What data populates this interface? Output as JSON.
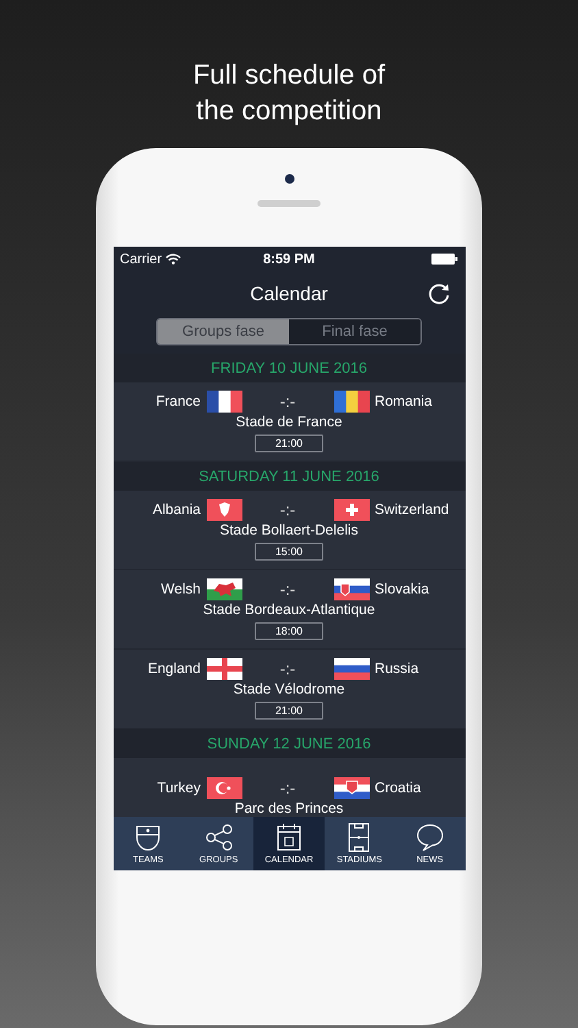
{
  "headline": "Full schedule of the competition",
  "status_bar": {
    "carrier": "Carrier",
    "time": "8:59 PM"
  },
  "nav": {
    "title": "Calendar"
  },
  "segments": [
    {
      "label": "Groups fase",
      "selected": true
    },
    {
      "label": "Final fase",
      "selected": false
    }
  ],
  "days": [
    {
      "date": "FRIDAY 10 JUNE 2016",
      "matches": [
        {
          "home": {
            "name": "France",
            "kind": "fr"
          },
          "away": {
            "name": "Romania",
            "kind": "ro"
          },
          "score": "-:-",
          "stadium": "Stade de France",
          "time": "21:00"
        }
      ]
    },
    {
      "date": "SATURDAY 11 JUNE 2016",
      "matches": [
        {
          "home": {
            "name": "Albania",
            "kind": "al"
          },
          "away": {
            "name": "Switzerland",
            "kind": "ch"
          },
          "score": "-:-",
          "stadium": "Stade Bollaert-Delelis",
          "time": "15:00"
        },
        {
          "home": {
            "name": "Welsh",
            "kind": "wa"
          },
          "away": {
            "name": "Slovakia",
            "kind": "sk"
          },
          "score": "-:-",
          "stadium": "Stade Bordeaux-Atlantique",
          "time": "18:00"
        },
        {
          "home": {
            "name": "England",
            "kind": "en"
          },
          "away": {
            "name": "Russia",
            "kind": "ru"
          },
          "score": "-:-",
          "stadium": "Stade Vélodrome",
          "time": "21:00"
        }
      ]
    },
    {
      "date": "SUNDAY 12 JUNE 2016",
      "matches": [
        {
          "home": {
            "name": "Turkey",
            "kind": "tr"
          },
          "away": {
            "name": "Croatia",
            "kind": "hr"
          },
          "score": "-:-",
          "stadium": "Parc des Princes"
        }
      ]
    }
  ],
  "tabs": [
    {
      "label": "TEAMS",
      "kind": "shield",
      "selected": false
    },
    {
      "label": "GROUPS",
      "kind": "share",
      "selected": false
    },
    {
      "label": "CALENDAR",
      "kind": "calendar",
      "selected": true
    },
    {
      "label": "STADIUMS",
      "kind": "pitch",
      "selected": false
    },
    {
      "label": "NEWS",
      "kind": "bubble",
      "selected": false
    }
  ]
}
